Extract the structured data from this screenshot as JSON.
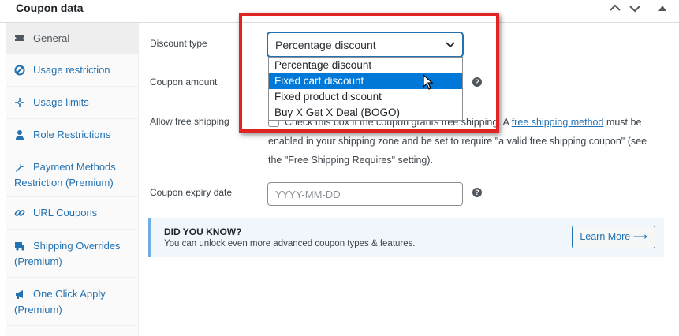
{
  "panel": {
    "title": "Coupon data"
  },
  "tabs": [
    {
      "label": "General",
      "icon": "ticket-icon"
    },
    {
      "label": "Usage restriction",
      "icon": "block-icon"
    },
    {
      "label": "Usage limits",
      "icon": "crosshair-icon"
    },
    {
      "label": "Role Restrictions",
      "icon": "user-icon"
    },
    {
      "label": "Payment Methods Restriction (Premium)",
      "icon": "wrench-icon"
    },
    {
      "label": "URL Coupons",
      "icon": "link-icon"
    },
    {
      "label": "Shipping Overrides (Premium)",
      "icon": "truck-icon"
    },
    {
      "label": "One Click Apply (Premium)",
      "icon": "megaphone-icon"
    }
  ],
  "general": {
    "discount_type_label": "Discount type",
    "discount_type_value": "Percentage discount",
    "discount_type_options": [
      "Percentage discount",
      "Fixed cart discount",
      "Fixed product discount",
      "Buy X Get X Deal (BOGO)"
    ],
    "highlighted_option": "Fixed cart discount",
    "coupon_amount_label": "Coupon amount",
    "free_shipping_label": "Allow free shipping",
    "free_shipping_text_before": "Check this box if the coupon grants free shipping. A",
    "free_shipping_link": "free shipping method",
    "free_shipping_text_after": "must be enabled in your shipping zone and be set to require \"a valid free shipping coupon\" (see the \"Free Shipping Requires\" setting).",
    "expiry_label": "Coupon expiry date",
    "expiry_placeholder": "YYYY-MM-DD",
    "help_glyph": "?"
  },
  "notice": {
    "title": "DID YOU KNOW?",
    "text": "You can unlock even more advanced coupon types & features.",
    "button_label": "Learn More ⟶"
  },
  "colors": {
    "accent": "#2271b1",
    "selected_option": "#0078d7",
    "highlight_box": "#e02424"
  }
}
